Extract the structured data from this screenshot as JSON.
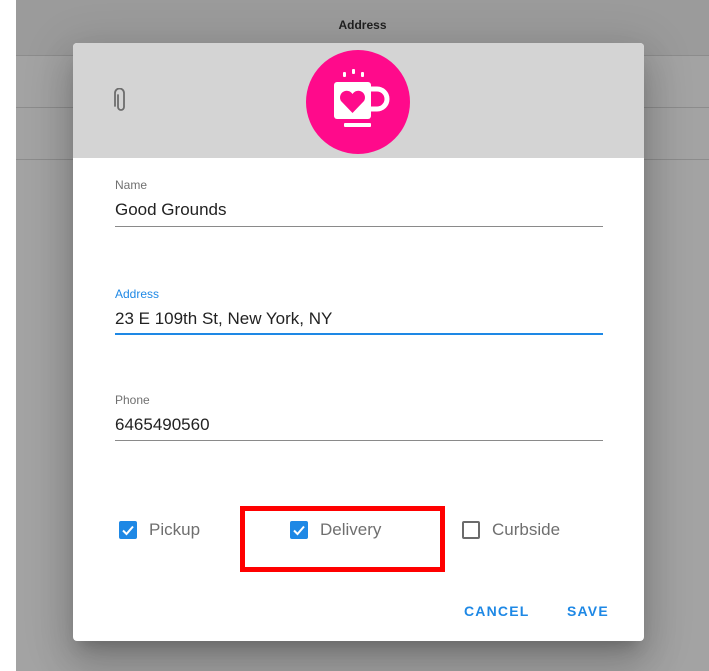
{
  "background": {
    "toolbar_title": "Address"
  },
  "dialog": {
    "header": {
      "attach_icon": "paperclip-icon",
      "logo_icon": "coffee-mug-heart-icon",
      "logo_color": "#ff0a8b"
    },
    "fields": {
      "name": {
        "label": "Name",
        "value": "Good Grounds"
      },
      "address": {
        "label": "Address",
        "value": "23 E 109th St, New York, NY",
        "focused": true
      },
      "phone": {
        "label": "Phone",
        "value": "6465490560"
      }
    },
    "options": {
      "pickup": {
        "label": "Pickup",
        "checked": true
      },
      "delivery": {
        "label": "Delivery",
        "checked": true,
        "highlighted": true
      },
      "curbside": {
        "label": "Curbside",
        "checked": false
      }
    },
    "actions": {
      "cancel": "CANCEL",
      "save": "SAVE"
    },
    "accent_color": "#1e88e5",
    "highlight_color": "#ff0000"
  }
}
